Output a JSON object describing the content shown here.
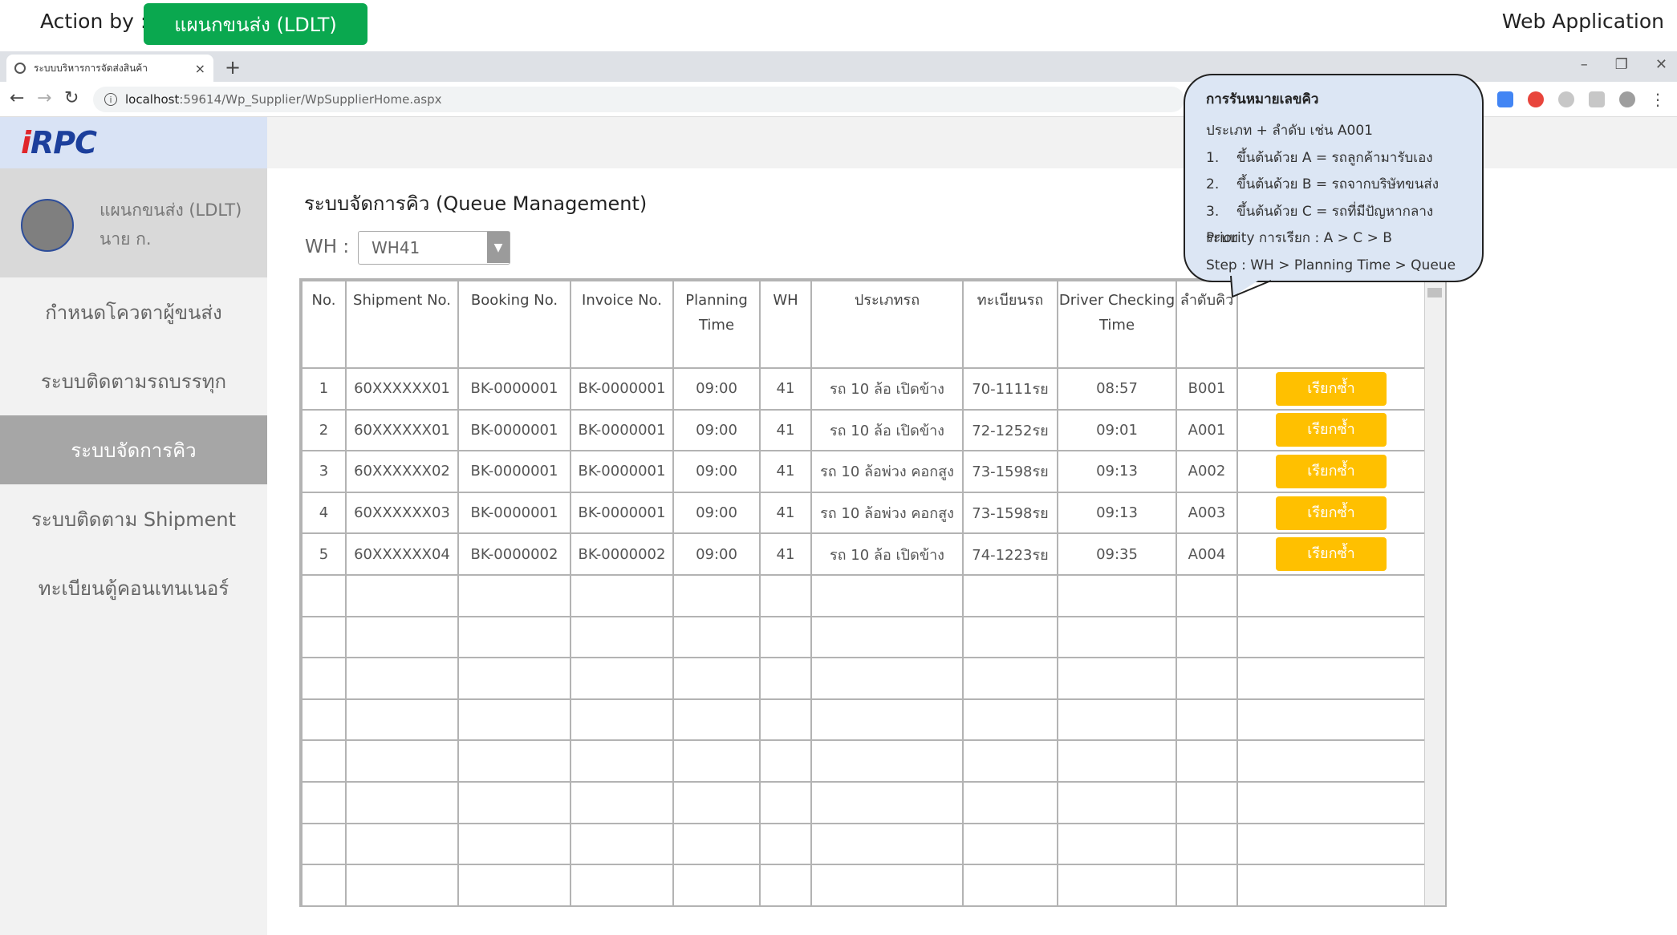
{
  "top": {
    "action_label": "Action by :",
    "action_button": "แผนกขนส่ง (LDLT)",
    "web_app_label": "Web Application"
  },
  "browser": {
    "tab_title": "ระบบบริหารการจัดส่งสินค้า",
    "tab_close": "×",
    "new_tab": "+",
    "url_host": "localhost",
    "url_path": ":59614/Wp_Supplier/WpSupplierHome.aspx",
    "win_minimize": "–",
    "win_restore": "❐",
    "win_close": "✕",
    "back": "←",
    "forward": "→",
    "reload": "↻",
    "menu": "⋮",
    "ext_colors": [
      "#4285f4",
      "#e8453c",
      "#999999",
      "#999999",
      "#999999"
    ]
  },
  "sidebar": {
    "logo_red": "i",
    "logo_blue": "RPC",
    "profile_dept": "แผนกขนส่ง (LDLT)",
    "profile_name": "นาย ก.",
    "items": [
      {
        "label": "กำหนดโควตาผู้ขนส่ง",
        "active": false
      },
      {
        "label": "ระบบติดตามรถบรรทุก",
        "active": false
      },
      {
        "label": "ระบบจัดการคิว",
        "active": true
      },
      {
        "label": "ระบบติดตาม Shipment",
        "active": false
      },
      {
        "label": "ทะเบียนตู้คอนเทนเนอร์",
        "active": false
      }
    ]
  },
  "main": {
    "title": "ระบบจัดการคิว (Queue Management)",
    "wh_label": "WH :",
    "wh_value": "WH41",
    "wh_arrow": "▼",
    "columns": [
      "No.",
      "Shipment No.",
      "Booking No.",
      "Invoice No.",
      "Planning Time",
      "WH",
      "ประเภทรถ",
      "ทะเบียนรถ",
      "Driver Checking Time",
      "ลำดับคิว",
      ""
    ],
    "rows": [
      [
        "1",
        "60XXXXXX01",
        "BK-0000001",
        "BK-0000001",
        "09:00",
        "41",
        "รถ 10 ล้อ เปิดข้าง",
        "70-1111รย",
        "08:57",
        "B001"
      ],
      [
        "2",
        "60XXXXXX01",
        "BK-0000001",
        "BK-0000001",
        "09:00",
        "41",
        "รถ 10 ล้อ เปิดข้าง",
        "72-1252รย",
        "09:01",
        "A001"
      ],
      [
        "3",
        "60XXXXXX02",
        "BK-0000001",
        "BK-0000001",
        "09:00",
        "41",
        "รถ 10 ล้อพ่วง คอกสูง",
        "73-1598รย",
        "09:13",
        "A002"
      ],
      [
        "4",
        "60XXXXXX03",
        "BK-0000001",
        "BK-0000001",
        "09:00",
        "41",
        "รถ 10 ล้อพ่วง คอกสูง",
        "73-1598รย",
        "09:13",
        "A003"
      ],
      [
        "5",
        "60XXXXXX04",
        "BK-0000002",
        "BK-0000002",
        "09:00",
        "41",
        "รถ 10 ล้อ เปิดข้าง",
        "74-1223รย",
        "09:35",
        "A004"
      ]
    ],
    "recall_label": "เรียกซ้ำ",
    "empty_rows": 8
  },
  "callout": {
    "title": "การรันหมายเลขคิว",
    "line1": "ประเภท + ลำดับ เช่น A001",
    "items": [
      {
        "num": "1.",
        "text": "ขึ้นต้นด้วย A = รถลูกค้ามารับเอง"
      },
      {
        "num": "2.",
        "text": "ขึ้นต้นด้วย B = รถจากบริษัทขนส่ง"
      },
      {
        "num": "3.",
        "text": "ขึ้นต้นด้วย C = รถที่มีปัญหากลางระบบ"
      }
    ],
    "priority": "Priority การเรียก : A > C > B",
    "step": "Step : WH > Planning Time > Queue"
  }
}
